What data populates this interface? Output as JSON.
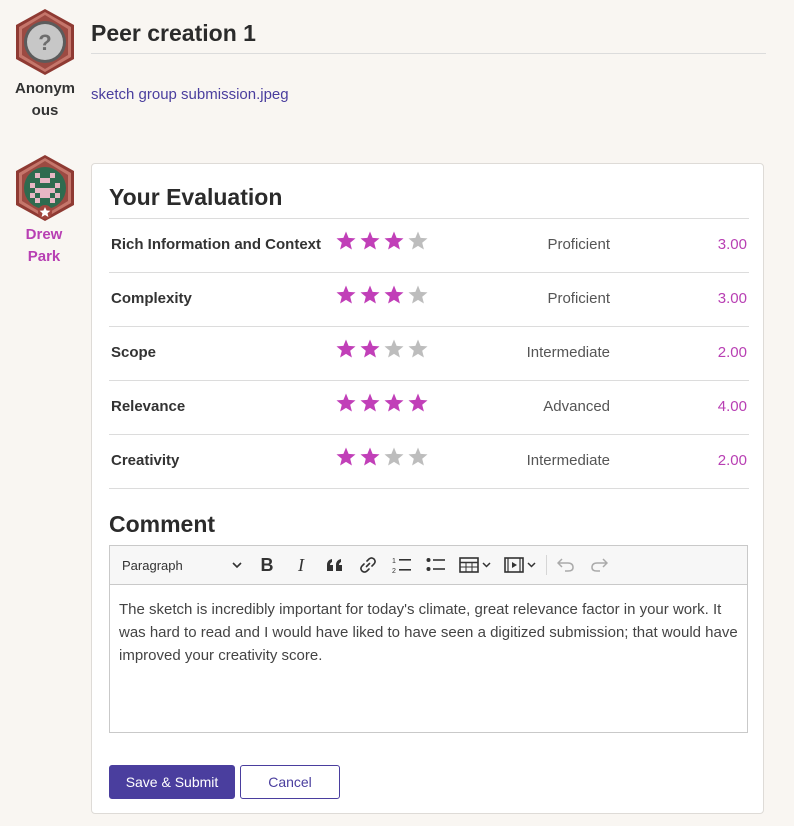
{
  "peer": {
    "title": "Peer creation 1",
    "author_name": "Anonymous",
    "author_name_line1": "Anonym",
    "author_name_line2": "ous",
    "attachment": "sketch group submission.jpeg"
  },
  "evaluator": {
    "name_line1": "Drew",
    "name_line2": "Park"
  },
  "evaluation": {
    "heading": "Your Evaluation",
    "max_stars": 4,
    "criteria": [
      {
        "name": "Rich Information and Context",
        "rating": 3,
        "level": "Proficient",
        "score": "3.00"
      },
      {
        "name": "Complexity",
        "rating": 3,
        "level": "Proficient",
        "score": "3.00"
      },
      {
        "name": "Scope",
        "rating": 2,
        "level": "Intermediate",
        "score": "2.00"
      },
      {
        "name": "Relevance",
        "rating": 4,
        "level": "Advanced",
        "score": "4.00"
      },
      {
        "name": "Creativity",
        "rating": 2,
        "level": "Intermediate",
        "score": "2.00"
      }
    ]
  },
  "comment": {
    "heading": "Comment",
    "format_select": "Paragraph",
    "text": "The sketch is incredibly important for today's climate, great relevance factor in your work. It was hard to read and I would have liked to have seen a digitized submission; that would have improved your creativity score."
  },
  "actions": {
    "submit_label": "Save & Submit",
    "cancel_label": "Cancel"
  },
  "colors": {
    "star_filled": "#c13fb8",
    "star_empty": "#bdbdbd",
    "accent": "#4a3e9e",
    "score": "#b83fb3",
    "evaluator_name": "#b83fb3"
  }
}
